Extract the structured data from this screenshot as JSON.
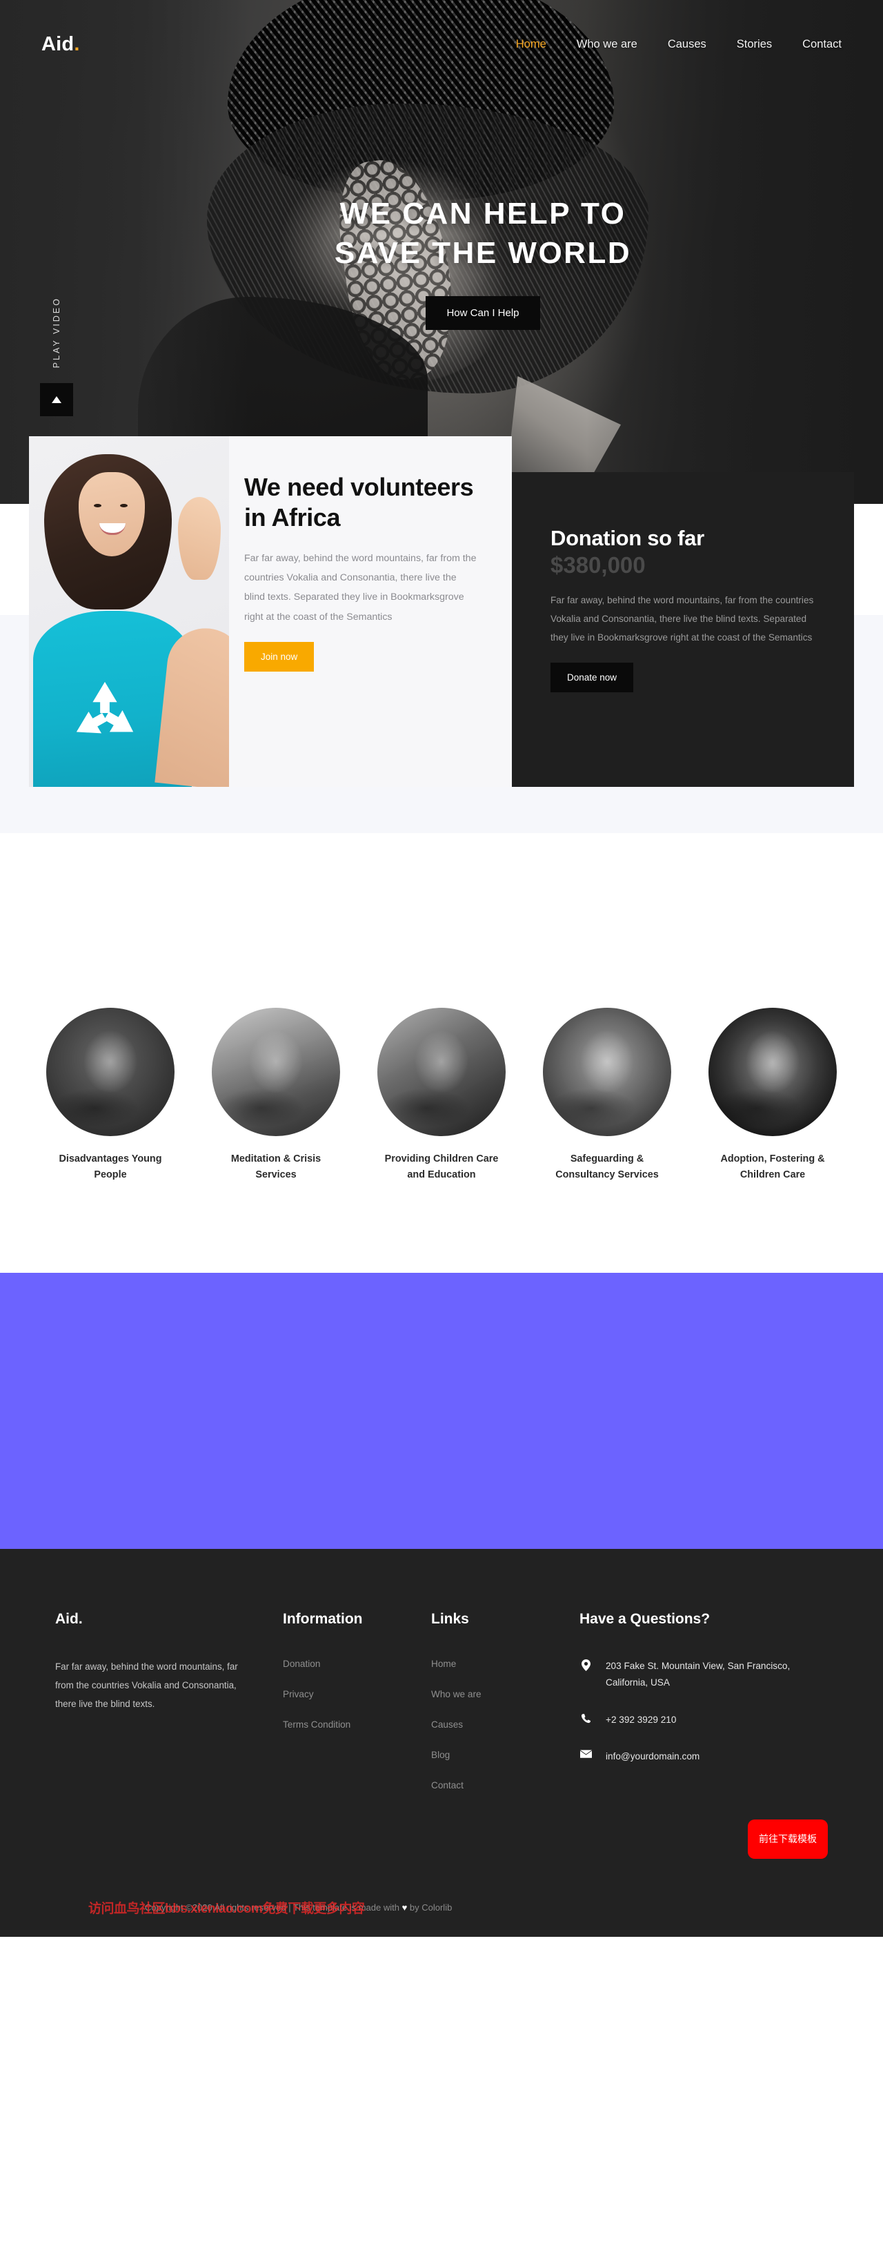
{
  "header": {
    "brand": "Aid",
    "brand_dot": ".",
    "nav": [
      {
        "label": "Home",
        "active": true
      },
      {
        "label": "Who we are",
        "active": false
      },
      {
        "label": "Causes",
        "active": false
      },
      {
        "label": "Stories",
        "active": false
      },
      {
        "label": "Contact",
        "active": false
      }
    ]
  },
  "hero": {
    "title_line1": "WE CAN HELP TO",
    "title_line2": "SAVE THE WORLD",
    "cta_label": "How Can I Help",
    "play_label": "PLAY VIDEO",
    "play_icon": "play-triangle-icon"
  },
  "volunteer": {
    "title": "We need volunteers in Africa",
    "text": "Far far away, behind the word mountains, far from the countries Vokalia and Consonantia, there live the blind texts. Separated they live in Bookmarksgrove right at the coast of the Semantics",
    "cta_label": "Join now",
    "cta_color": "#f9a900",
    "image_alt": "smiling-volunteer-with-recycle-shirt"
  },
  "donation": {
    "title": "Donation so far",
    "amount": "$380,000",
    "text": "Far far away, behind the word mountains, far from the countries Vokalia and Consonantia, there live the blind texts. Separated they live in Bookmarksgrove right at the coast of the Semantics",
    "cta_label": "Donate now"
  },
  "causes": [
    {
      "label": "Disadvantages Young People",
      "image_alt": "young-boy-portrait"
    },
    {
      "label": "Meditation & Crisis Services",
      "image_alt": "aid-worker-with-child"
    },
    {
      "label": "Providing Children Care and Education",
      "image_alt": "children-in-classroom"
    },
    {
      "label": "Safeguarding & Consultancy Services",
      "image_alt": "young-girl-portrait"
    },
    {
      "label": "Adoption, Fostering & Children Care",
      "image_alt": "elderly-man-portrait"
    }
  ],
  "footer": {
    "brand": "Aid",
    "brand_dot": ".",
    "about": "Far far away, behind the word mountains, far from the countries Vokalia and Consonantia, there live the blind texts.",
    "information": {
      "heading": "Information",
      "items": [
        "Donation",
        "Privacy",
        "Terms Condition"
      ]
    },
    "links": {
      "heading": "Links",
      "items": [
        "Home",
        "Who we are",
        "Causes",
        "Blog",
        "Contact"
      ]
    },
    "contact": {
      "heading": "Have a Questions?",
      "address": "203 Fake St. Mountain View, San Francisco, California, USA",
      "phone": "+2 392 3929 210",
      "email": "info@yourdomain.com",
      "address_icon": "map-pin-icon",
      "phone_icon": "phone-icon",
      "email_icon": "envelope-icon"
    },
    "copyright": "Copyright ©2020 All rights reserved | This template is made with ",
    "copyright_suffix": " by Colorlib",
    "watermark": "访问血鸟社区bbs.xieniao.com免费下载更多内容",
    "download_button": "前往下载模板"
  },
  "colors": {
    "accent": "#f5a623",
    "join_button": "#f9a900",
    "dark_panel": "#1f1f1f",
    "footer_bg": "#222222",
    "purple_band": "#6c63ff",
    "watermark_red": "#ff0000"
  }
}
